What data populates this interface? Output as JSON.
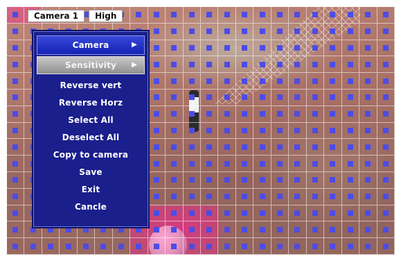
{
  "status": {
    "camera": "Camera  1",
    "level": "High"
  },
  "menu": {
    "items": [
      {
        "label": "Camera",
        "has_submenu": true,
        "state": "selected"
      },
      {
        "label": "Sensitivity",
        "has_submenu": true,
        "state": "highlighted"
      },
      {
        "label": "Reverse vert"
      },
      {
        "label": "Reverse Horz"
      },
      {
        "label": "Select All"
      },
      {
        "label": "Deselect All"
      },
      {
        "label": "Copy to camera"
      },
      {
        "label": "Save"
      },
      {
        "label": "Exit"
      },
      {
        "label": "Cancle"
      }
    ],
    "submenu_arrow": "▶"
  },
  "colors": {
    "menu_bg": "#1a1f8c",
    "selected_item": "#1422b5",
    "highlighted_item": "#8f8f8f",
    "motion_marker": "#4c4ce6",
    "grid_line": "#ffffff"
  },
  "grid": {
    "columns": 22,
    "rows": 15
  }
}
